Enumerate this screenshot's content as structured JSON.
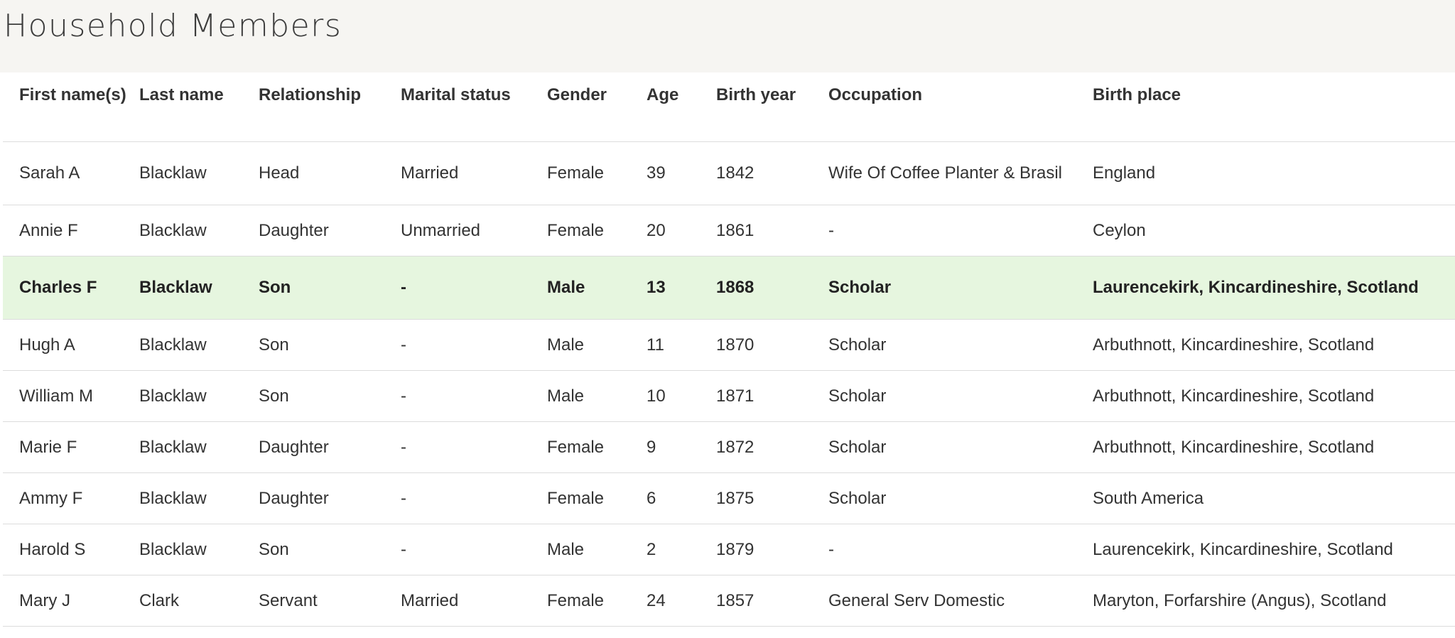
{
  "page": {
    "title": "Household Members"
  },
  "table": {
    "headers": {
      "first_name": "First name(s)",
      "last_name": "Last name",
      "relationship": "Relationship",
      "marital_status": "Marital status",
      "gender": "Gender",
      "age": "Age",
      "birth_year": "Birth year",
      "occupation": "Occupation",
      "birth_place": "Birth place"
    },
    "rows": [
      {
        "first_name": "Sarah A",
        "last_name": "Blacklaw",
        "relationship": "Head",
        "marital_status": "Married",
        "gender": "Female",
        "age": "39",
        "birth_year": "1842",
        "occupation": "Wife Of Coffee Planter & Brasil",
        "birth_place": "England",
        "highlighted": false
      },
      {
        "first_name": "Annie F",
        "last_name": "Blacklaw",
        "relationship": "Daughter",
        "marital_status": "Unmarried",
        "gender": "Female",
        "age": "20",
        "birth_year": "1861",
        "occupation": "-",
        "birth_place": "Ceylon",
        "highlighted": false
      },
      {
        "first_name": "Charles F",
        "last_name": "Blacklaw",
        "relationship": "Son",
        "marital_status": "-",
        "gender": "Male",
        "age": "13",
        "birth_year": "1868",
        "occupation": "Scholar",
        "birth_place": "Laurencekirk, Kincardineshire, Scotland",
        "highlighted": true
      },
      {
        "first_name": "Hugh A",
        "last_name": "Blacklaw",
        "relationship": "Son",
        "marital_status": "-",
        "gender": "Male",
        "age": "11",
        "birth_year": "1870",
        "occupation": "Scholar",
        "birth_place": "Arbuthnott, Kincardineshire, Scotland",
        "highlighted": false
      },
      {
        "first_name": "William M",
        "last_name": "Blacklaw",
        "relationship": "Son",
        "marital_status": "-",
        "gender": "Male",
        "age": "10",
        "birth_year": "1871",
        "occupation": "Scholar",
        "birth_place": "Arbuthnott, Kincardineshire, Scotland",
        "highlighted": false
      },
      {
        "first_name": "Marie F",
        "last_name": "Blacklaw",
        "relationship": "Daughter",
        "marital_status": "-",
        "gender": "Female",
        "age": "9",
        "birth_year": "1872",
        "occupation": "Scholar",
        "birth_place": "Arbuthnott, Kincardineshire, Scotland",
        "highlighted": false
      },
      {
        "first_name": "Ammy F",
        "last_name": "Blacklaw",
        "relationship": "Daughter",
        "marital_status": "-",
        "gender": "Female",
        "age": "6",
        "birth_year": "1875",
        "occupation": "Scholar",
        "birth_place": "South America",
        "highlighted": false
      },
      {
        "first_name": "Harold S",
        "last_name": "Blacklaw",
        "relationship": "Son",
        "marital_status": "-",
        "gender": "Male",
        "age": "2",
        "birth_year": "1879",
        "occupation": "-",
        "birth_place": "Laurencekirk, Kincardineshire, Scotland",
        "highlighted": false
      },
      {
        "first_name": "Mary J",
        "last_name": "Clark",
        "relationship": "Servant",
        "marital_status": "Married",
        "gender": "Female",
        "age": "24",
        "birth_year": "1857",
        "occupation": "General Serv Domestic",
        "birth_place": "Maryton, Forfarshire (Angus), Scotland",
        "highlighted": false
      }
    ]
  },
  "colors": {
    "header_band": "#f6f5f2",
    "highlight_row": "#e6f6df",
    "row_divider": "#dcdcdc",
    "text": "#333333"
  }
}
